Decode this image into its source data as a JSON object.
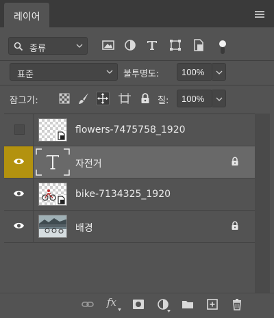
{
  "panel": {
    "tab_title": "레이어"
  },
  "filter": {
    "kind_label": "종류",
    "icons": [
      "image-filter-icon",
      "adjustment-filter-icon",
      "type-filter-icon",
      "shape-filter-icon",
      "smart-object-filter-icon",
      "filter-toggle-icon"
    ]
  },
  "blend": {
    "mode": "표준",
    "opacity_label": "불투명도:",
    "opacity_value": "100%"
  },
  "lock": {
    "label": "잠그기:",
    "fill_label": "칠:",
    "fill_value": "100%"
  },
  "layers": [
    {
      "name": "flowers-7475758_1920",
      "visible": false,
      "selected": false,
      "kind": "smart",
      "locked": false
    },
    {
      "name": "자전거",
      "visible": true,
      "selected": true,
      "kind": "type",
      "locked": true
    },
    {
      "name": "bike-7134325_1920",
      "visible": true,
      "selected": false,
      "kind": "smart",
      "locked": false
    },
    {
      "name": "배경",
      "visible": true,
      "selected": false,
      "kind": "image",
      "locked": true
    }
  ],
  "footer": {
    "fx_label": "fx",
    "buttons": [
      "link-layers-icon",
      "fx-icon",
      "add-mask-icon",
      "new-adjustment-icon",
      "new-group-icon",
      "new-layer-icon",
      "delete-layer-icon"
    ]
  },
  "colors": {
    "panel_bg": "#535353",
    "selected_row": "#696969",
    "visibility_highlight": "#b3920f"
  }
}
